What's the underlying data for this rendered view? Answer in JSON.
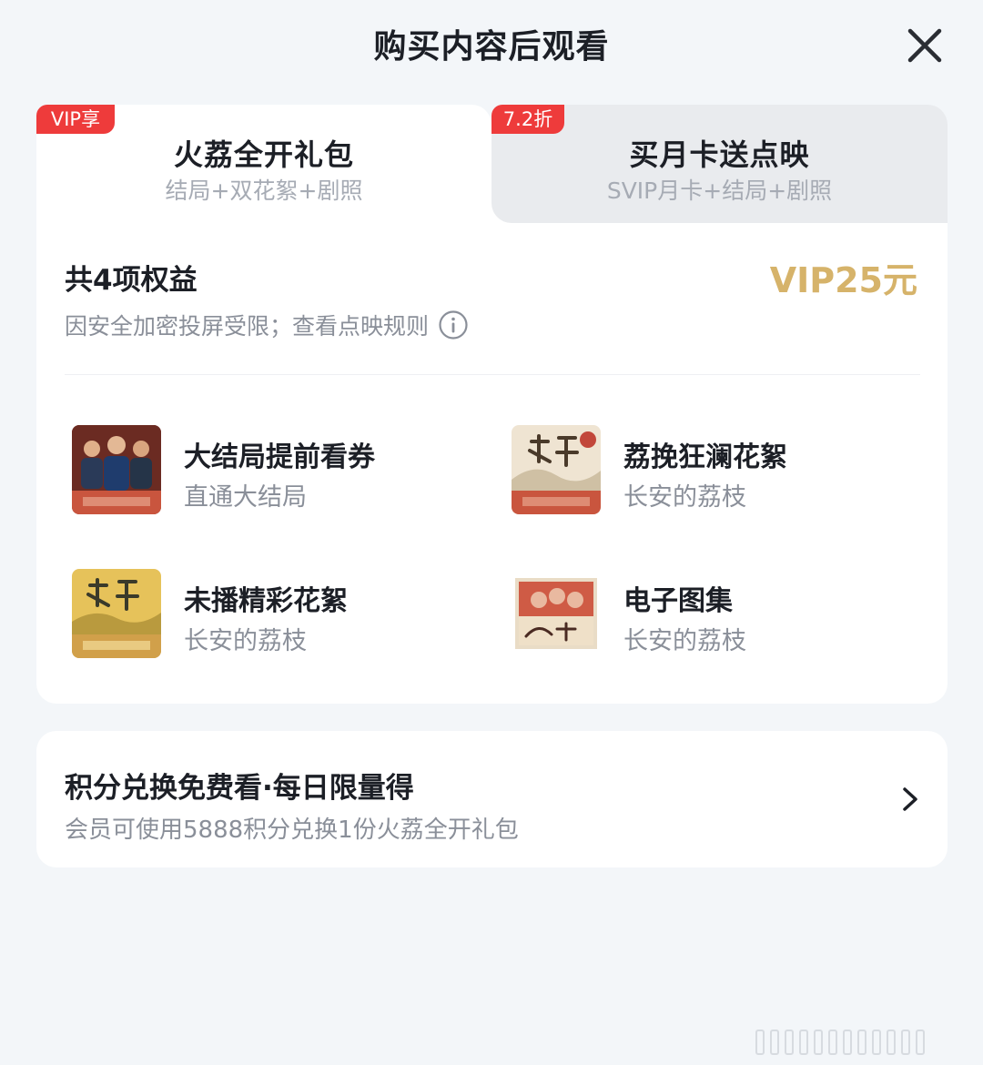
{
  "header": {
    "title": "购买内容后观看",
    "close_icon": "close-icon"
  },
  "tabs": [
    {
      "badge": "VIP享",
      "title": "火荔全开礼包",
      "subtitle": "结局+双花絮+剧照",
      "selected": true
    },
    {
      "badge": "7.2折",
      "title": "买月卡送点映",
      "subtitle": "SVIP月卡+结局+剧照",
      "selected": false
    }
  ],
  "package": {
    "benefit_count_label": "共4项权益",
    "price": "VIP25元",
    "notice": "因安全加密投屏受限；查看点映规则",
    "info_icon": "info-icon",
    "items": [
      {
        "title": "大结局提前看券",
        "subtitle": "直通大结局",
        "icon": "ticket-thumbnail"
      },
      {
        "title": "荔挽狂澜花絮",
        "subtitle": "长安的荔枝",
        "icon": "behind-scenes-thumbnail"
      },
      {
        "title": "未播精彩花絮",
        "subtitle": "长安的荔枝",
        "icon": "unaired-thumbnail"
      },
      {
        "title": "电子图集",
        "subtitle": "长安的荔枝",
        "icon": "photo-album-thumbnail"
      }
    ]
  },
  "points": {
    "title": "积分兑换免费看·每日限量得",
    "subtitle": "会员可使用5888积分兑换1份火荔全开礼包",
    "chevron_icon": "chevron-right-icon"
  },
  "colors": {
    "accent_gold": "#d6b36a",
    "badge_red": "#ee3b3b",
    "background": "#f3f6f9"
  }
}
